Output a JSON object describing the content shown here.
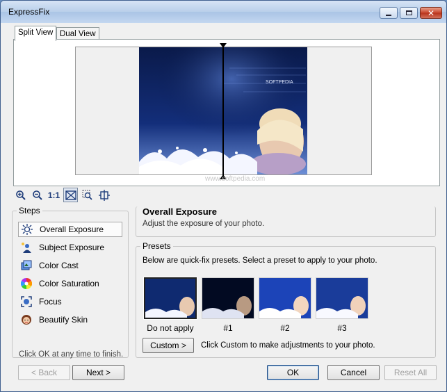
{
  "window": {
    "title": "ExpressFix"
  },
  "tabs": [
    {
      "label": "Split View",
      "active": true
    },
    {
      "label": "Dual View",
      "active": false
    }
  ],
  "preview": {
    "watermark": "www.softpedia.com",
    "photo_brand": "SOFTPEDIA"
  },
  "toolbar": {
    "tools": [
      "zoom-in-icon",
      "zoom-out-icon",
      "actual-size-icon",
      "split-view-icon",
      "zoom-region-icon",
      "split-position-icon"
    ],
    "actual_size_label": "1:1"
  },
  "steps": {
    "group_label": "Steps",
    "items": [
      {
        "label": "Overall Exposure",
        "icon": "sun-icon",
        "selected": true
      },
      {
        "label": "Subject Exposure",
        "icon": "person-light-icon",
        "selected": false
      },
      {
        "label": "Color Cast",
        "icon": "color-cast-icon",
        "selected": false
      },
      {
        "label": "Color Saturation",
        "icon": "color-wheel-icon",
        "selected": false
      },
      {
        "label": "Focus",
        "icon": "focus-icon",
        "selected": false
      },
      {
        "label": "Beautify Skin",
        "icon": "face-icon",
        "selected": false
      }
    ],
    "hint": "Click OK at any time to finish."
  },
  "section": {
    "title": "Overall Exposure",
    "description": "Adjust the exposure of your photo."
  },
  "presets": {
    "group_label": "Presets",
    "intro": "Below are quick-fix presets. Select a preset to apply to your photo.",
    "items": [
      {
        "label": "Do not apply",
        "selected": true
      },
      {
        "label": "#1",
        "selected": false
      },
      {
        "label": "#2",
        "selected": false
      },
      {
        "label": "#3",
        "selected": false
      }
    ],
    "custom_button": "Custom >",
    "custom_hint": "Click Custom to make adjustments to your photo."
  },
  "buttons": {
    "back": "< Back",
    "next": "Next >",
    "ok": "OK",
    "cancel": "Cancel",
    "reset_all": "Reset All"
  },
  "colors": {
    "accent": "#1e3c7a",
    "photo_bg": "#0d1f55"
  }
}
